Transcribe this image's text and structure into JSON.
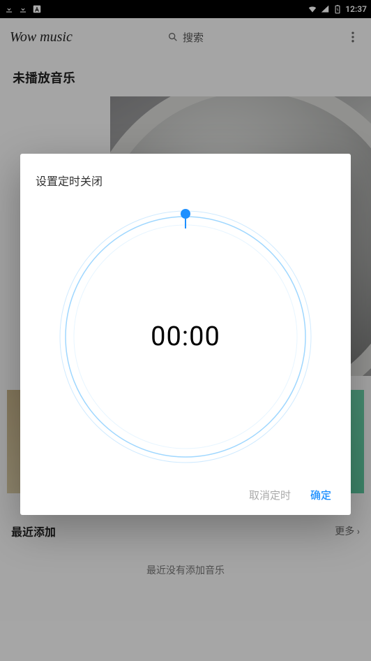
{
  "statusbar": {
    "time": "12:37"
  },
  "topbar": {
    "app_title": "Wow music",
    "search_placeholder": "搜索"
  },
  "sections": {
    "not_playing": "未播放音乐",
    "recent": "最近添加",
    "more": "更多",
    "empty": "最近没有添加音乐"
  },
  "dialog": {
    "title": "设置定时关闭",
    "time": "00:00",
    "cancel": "取消定时",
    "confirm": "确定"
  }
}
